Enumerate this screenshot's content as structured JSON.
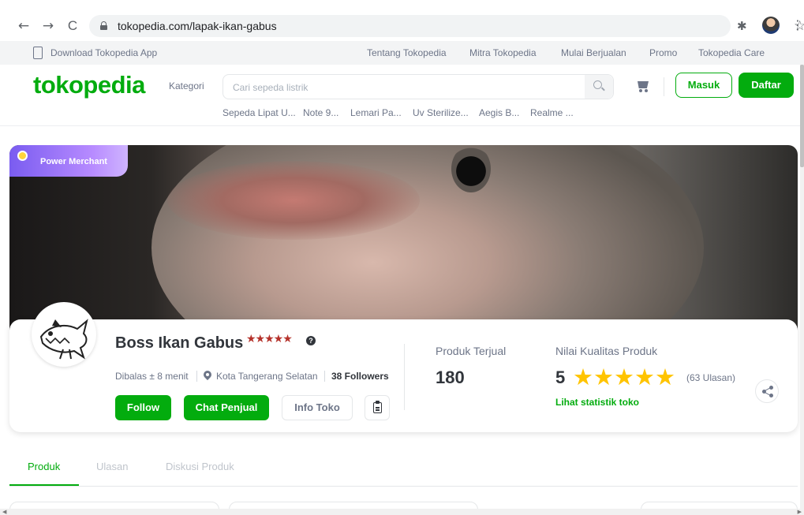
{
  "browser": {
    "url": "tokopedia.com/lapak-ikan-gabus",
    "back_icon": "←",
    "forward_icon": "→",
    "reload_icon": "C",
    "bookmark_icon": "☆",
    "extensions_icon": "✱",
    "menu_icon": "⋮"
  },
  "topbar": {
    "download_app": "Download Tokopedia App",
    "links": [
      "Tentang Tokopedia",
      "Mitra Tokopedia",
      "Mulai Berjualan",
      "Promo",
      "Tokopedia Care"
    ]
  },
  "header": {
    "logo": "tokopedia",
    "kategori": "Kategori",
    "search_placeholder": "Cari sepeda listrik",
    "suggestions": [
      "Sepeda Lipat U...",
      "Note 9...",
      "Lemari Pa...",
      "Uv Sterilize...",
      "Aegis B...",
      "Realme ..."
    ],
    "login_label": "Masuk",
    "register_label": "Daftar"
  },
  "banner": {
    "badge_label": "Power Merchant"
  },
  "shop": {
    "name": "Boss Ikan Gabus",
    "badge_medals": "★★★★★",
    "reply_time": "Dibalas ± 8 menit",
    "location": "Kota Tangerang Selatan",
    "followers": "38 Followers",
    "follow_label": "Follow",
    "chat_label": "Chat Penjual",
    "info_label": "Info Toko"
  },
  "stats": {
    "sold_label": "Produk Terjual",
    "sold_value": "180",
    "quality_label": "Nilai Kualitas Produk",
    "rating_value": "5",
    "stars": "★★★★★",
    "rating_score": 5,
    "reviews": "(63 Ulasan)",
    "stats_link": "Lihat statistik toko"
  },
  "tabs": [
    "Produk",
    "Ulasan",
    "Diskusi Produk"
  ],
  "colors": {
    "brand_green": "#03ac0e",
    "star_yellow": "#ffc400",
    "power_merchant_purple": "#7a5cf0",
    "text_dark": "#31353b",
    "text_muted": "#6d7588"
  }
}
